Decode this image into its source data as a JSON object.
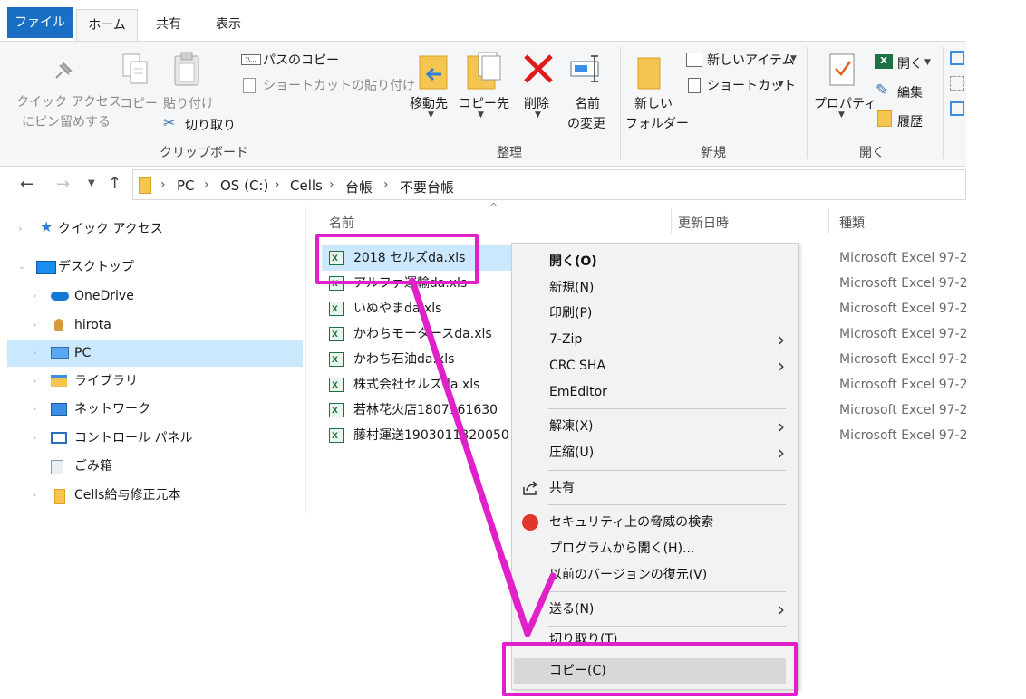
{
  "tabs": {
    "file": "ファイル",
    "home": "ホーム",
    "share": "共有",
    "view": "表示"
  },
  "ribbon": {
    "pin_line1": "クイック アクセス",
    "pin_line2": "にピン留めする",
    "copy": "コピー",
    "paste": "貼り付け",
    "copy_path": "パスのコピー",
    "paste_shortcut": "ショートカットの貼り付け",
    "cut": "切り取り",
    "group_clipboard": "クリップボード",
    "move_to": "移動先",
    "copy_to": "コピー先",
    "delete": "削除",
    "rename_line1": "名前",
    "rename_line2": "の変更",
    "group_organize": "整理",
    "new_folder_line1": "新しい",
    "new_folder_line2": "フォルダー",
    "new_item": "新しいアイテム",
    "easy_access": "ショートカット",
    "group_new": "新規",
    "properties": "プロパティ",
    "open": "開く",
    "edit": "編集",
    "history": "履歴",
    "group_open": "開く"
  },
  "address": {
    "crumbs": [
      "PC",
      "OS (C:)",
      "Cells",
      "台帳",
      "不要台帳"
    ]
  },
  "nav": [
    {
      "label": "クイック アクセス",
      "icon": "star-icon"
    },
    {
      "label": "デスクトップ",
      "icon": "desktop-icon"
    },
    {
      "label": "OneDrive",
      "icon": "cloud-icon"
    },
    {
      "label": "hirota",
      "icon": "user-icon"
    },
    {
      "label": "PC",
      "icon": "pc-icon"
    },
    {
      "label": "ライブラリ",
      "icon": "library-icon"
    },
    {
      "label": "ネットワーク",
      "icon": "network-icon"
    },
    {
      "label": "コントロール パネル",
      "icon": "control-panel-icon"
    },
    {
      "label": "ごみ箱",
      "icon": "recycle-bin-icon"
    },
    {
      "label": "Cells給与修正元本",
      "icon": "folder-icon"
    }
  ],
  "columns": {
    "name": "名前",
    "modified": "更新日時",
    "type": "種類"
  },
  "files": [
    {
      "name": "2018 セルズda.xls",
      "type": "Microsoft Excel 97-2"
    },
    {
      "name": "アルファ運輸da.xls",
      "type": "Microsoft Excel 97-2"
    },
    {
      "name": "いぬやまda.xls",
      "type": "Microsoft Excel 97-2"
    },
    {
      "name": "かわちモータースda.xls",
      "type": "Microsoft Excel 97-2"
    },
    {
      "name": "かわち石油da.xls",
      "type": "Microsoft Excel 97-2"
    },
    {
      "name": "株式会社セルズda.xls",
      "type": "Microsoft Excel 97-2"
    },
    {
      "name": "若林花火店1807161630",
      "type": "Microsoft Excel 97-2"
    },
    {
      "name": "藤村運送1903011320050",
      "type": "Microsoft Excel 97-2"
    }
  ],
  "context_menu": {
    "open": "開く(O)",
    "new": "新規(N)",
    "print": "印刷(P)",
    "zip": "7-Zip",
    "crc": "CRC SHA",
    "emeditor": "EmEditor",
    "extract": "解凍(X)",
    "compress": "圧縮(U)",
    "share": "共有",
    "scan": "セキュリティ上の脅威の検索",
    "open_with": "プログラムから開く(H)...",
    "restore": "以前のバージョンの復元(V)",
    "send_to": "送る(N)",
    "cut": "切り取り(T)",
    "copy": "コピー(C)"
  },
  "colors": {
    "accent": "#1a6fc4",
    "selection": "#cce8ff",
    "annotation": "#e020c9"
  }
}
